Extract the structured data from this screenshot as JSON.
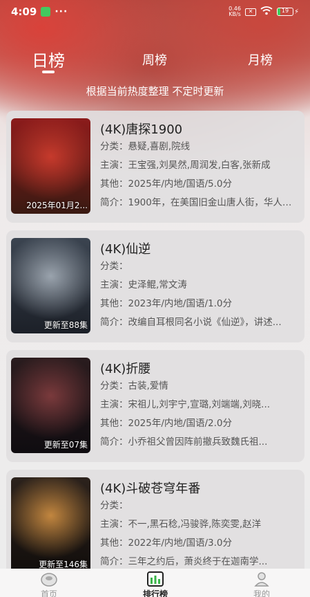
{
  "status_bar": {
    "time": "4:09",
    "notification_dots": "···",
    "net_speed": "0.46\nKB/s",
    "battery": "19"
  },
  "tabs": [
    {
      "label": "日榜",
      "active": true
    },
    {
      "label": "周榜",
      "active": false
    },
    {
      "label": "月榜",
      "active": false
    }
  ],
  "subtitle": "根据当前热度整理 不定时更新",
  "labels": {
    "category": "分类：",
    "cast": "主演：",
    "other": "其他：",
    "intro": "简介："
  },
  "items": [
    {
      "title": "(4K)唐探1900",
      "category": "悬疑,喜剧,院线",
      "cast": "王宝强,刘昊然,周润发,白客,张新成",
      "other": "2025年/内地/国语/5.0分",
      "intro": "1900年，在美国旧金山唐人街，华人谭...",
      "badge": "2025年01月2...",
      "poster_colors": [
        "#8c1b1b",
        "#c63a2c",
        "#3a1a12"
      ]
    },
    {
      "title": "(4K)仙逆",
      "category": "",
      "cast": "史泽鲲,常文涛",
      "other": "2023年/内地/国语/1.0分",
      "intro": "改编自耳根同名小说《仙逆》，讲述...",
      "badge": "更新至88集",
      "poster_colors": [
        "#3b4450",
        "#9aa3ad",
        "#1c2028"
      ]
    },
    {
      "title": "(4K)折腰",
      "category": "古装,爱情",
      "cast": "宋祖儿,刘宇宁,宣璐,刘端端,刘晓...",
      "other": "2025年/内地/国语/2.0分",
      "intro": "小乔祖父曾因阵前撤兵致魏氏祖...",
      "badge": "更新至07集",
      "poster_colors": [
        "#2a1c1e",
        "#7a3a3c",
        "#0f0c10"
      ]
    },
    {
      "title": "(4K)斗破苍穹年番",
      "category": "",
      "cast": "不一,黑石稔,冯骏骅,陈奕雯,赵洋",
      "other": "2022年/内地/国语/3.0分",
      "intro": "三年之约后，萧炎终于在迦南学...",
      "badge": "更新至146集",
      "poster_colors": [
        "#2c221c",
        "#c2863f",
        "#120e0c"
      ]
    }
  ],
  "nav": [
    {
      "label": "首页",
      "icon": "home-icon",
      "active": false
    },
    {
      "label": "排行榜",
      "icon": "ranking-icon",
      "active": true
    },
    {
      "label": "我的",
      "icon": "profile-icon",
      "active": false
    }
  ]
}
